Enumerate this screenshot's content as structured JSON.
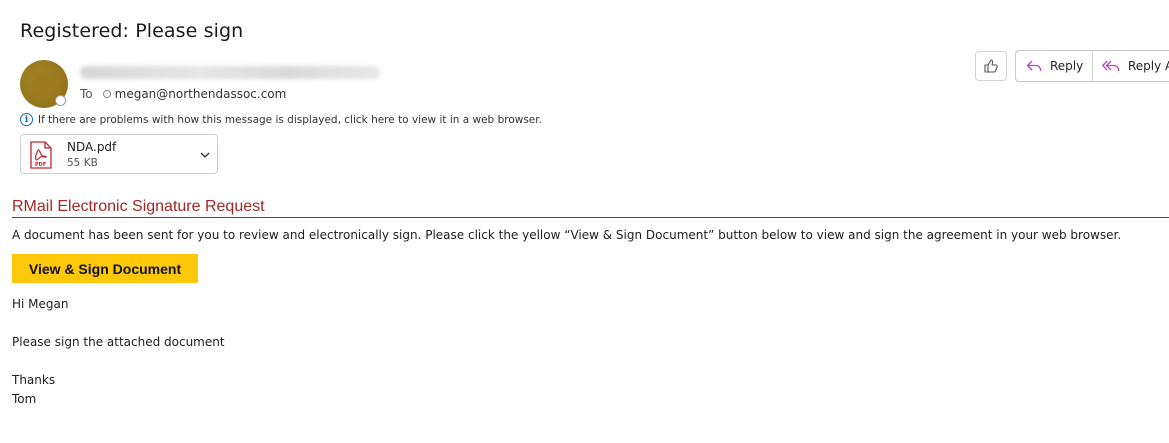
{
  "email": {
    "subject": "Registered: Please sign",
    "to_label": "To",
    "recipient": "megan@northendassoc.com",
    "info_banner": "If there are problems with how this message is displayed, click here to view it in a web browser.",
    "attachment": {
      "name": "NDA.pdf",
      "size": "55 KB",
      "icon": "pdf-file-icon"
    }
  },
  "actions": {
    "like_icon": "thumbs-up-icon",
    "reply_label": "Reply",
    "reply_all_label": "Reply A"
  },
  "body": {
    "heading": "RMail Electronic Signature Request",
    "intro": "A document has been sent for you to review and electronically sign. Please click the yellow “View & Sign Document” button below to view and sign the agreement in your web browser.",
    "sign_button": "View & Sign Document",
    "greeting": "Hi Megan",
    "message": "Please sign the attached document",
    "closing": "Thanks",
    "signature": "Tom"
  },
  "colors": {
    "heading_red": "#a32727",
    "button_yellow": "#fdc70a",
    "reply_accent": "#b146c2",
    "avatar_gold": "#9c7c1f"
  }
}
